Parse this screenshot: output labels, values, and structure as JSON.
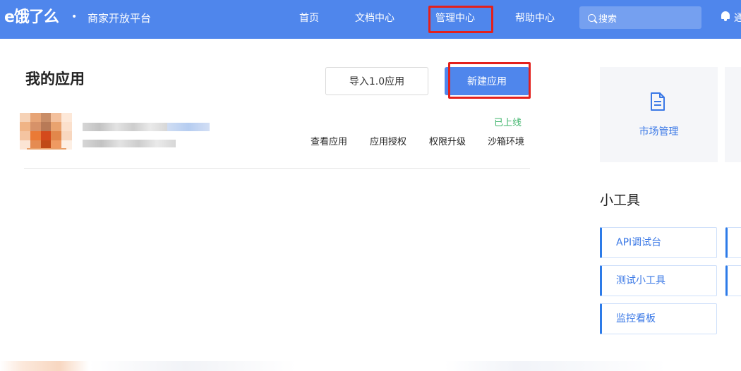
{
  "header": {
    "logo": "e饿了么",
    "separator": "•",
    "platform_name": "商家开放平台",
    "nav": [
      {
        "label": "首页"
      },
      {
        "label": "文档中心"
      },
      {
        "label": "管理中心"
      },
      {
        "label": "帮助中心"
      }
    ],
    "search": {
      "placeholder": "搜索"
    },
    "right_text": "通"
  },
  "main": {
    "title": "我的应用",
    "import_button": "导入1.0应用",
    "create_button": "新建应用",
    "app": {
      "status": "已上线",
      "actions": [
        {
          "label": "查看应用"
        },
        {
          "label": "应用授权"
        },
        {
          "label": "权限升级"
        },
        {
          "label": "沙箱环境"
        }
      ]
    }
  },
  "sidebar": {
    "market": {
      "label": "市场管理",
      "icon": "document-icon"
    },
    "tools_title": "小工具",
    "tools": [
      {
        "label": "API调试台"
      },
      {
        "label": "测试小工具"
      },
      {
        "label": "监控看板"
      }
    ]
  },
  "colors": {
    "brand_blue": "#4f86ec",
    "status_green": "#3fb46b",
    "link_blue": "#3a78e6",
    "highlight_red": "#e3201c"
  },
  "avatar_pixels": [
    "#f6d2b6",
    "#e7a476",
    "#c98d67",
    "#f3c09c",
    "#fde8d8",
    "#f0b486",
    "#d79269",
    "#b87a57",
    "#e9a36f",
    "#fbe0cc",
    "#f4c4a1",
    "#ea7a36",
    "#d44a1c",
    "#e2874b",
    "#f8d7bf",
    "#fbe4d4",
    "#e58b52",
    "#c04a18",
    "#ef9a62",
    "#fdefe4"
  ]
}
